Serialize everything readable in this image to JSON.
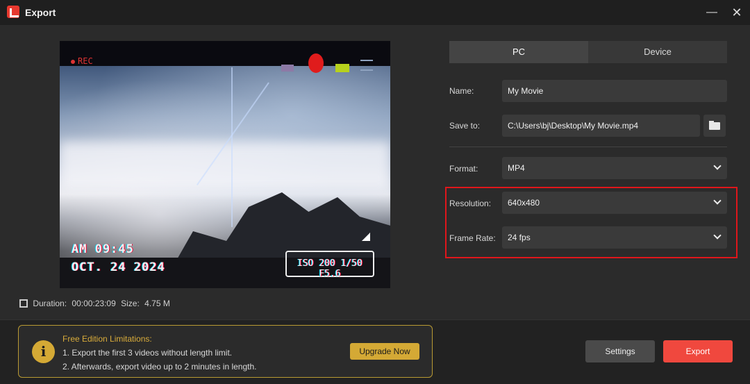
{
  "window": {
    "title": "Export",
    "minimize": "—",
    "close": "✕"
  },
  "preview": {
    "rec_text": "REC",
    "time_text": "AM  09:45",
    "date_text": "OCT.  24  2024",
    "camera_text": "ISO 200   1/50   F5.6"
  },
  "meta": {
    "duration_label": "Duration:",
    "duration": "00:00:23:09",
    "size_label": "Size:",
    "size": "4.75 M"
  },
  "tabs": [
    {
      "label": "PC"
    },
    {
      "label": "Device"
    }
  ],
  "fields": {
    "name": {
      "label": "Name:",
      "value": "My Movie"
    },
    "save_to": {
      "label": "Save to:",
      "value": "C:\\Users\\bj\\Desktop\\My Movie.mp4"
    },
    "format": {
      "label": "Format:",
      "value": "MP4"
    },
    "resolution": {
      "label": "Resolution:",
      "value": "640x480"
    },
    "frame_rate": {
      "label": "Frame Rate:",
      "value": "24 fps"
    }
  },
  "notice": {
    "title": "Free Edition Limitations:",
    "line1": "1. Export the first 3 videos without length limit.",
    "line2": "2. Afterwards, export video up to 2 minutes in length.",
    "icon": "i",
    "upgrade_label": "Upgrade Now"
  },
  "actions": {
    "settings_label": "Settings",
    "export_label": "Export"
  },
  "colors": {
    "accent": "#f0483e",
    "gold": "#d4a935",
    "highlight": "#e0161b"
  }
}
